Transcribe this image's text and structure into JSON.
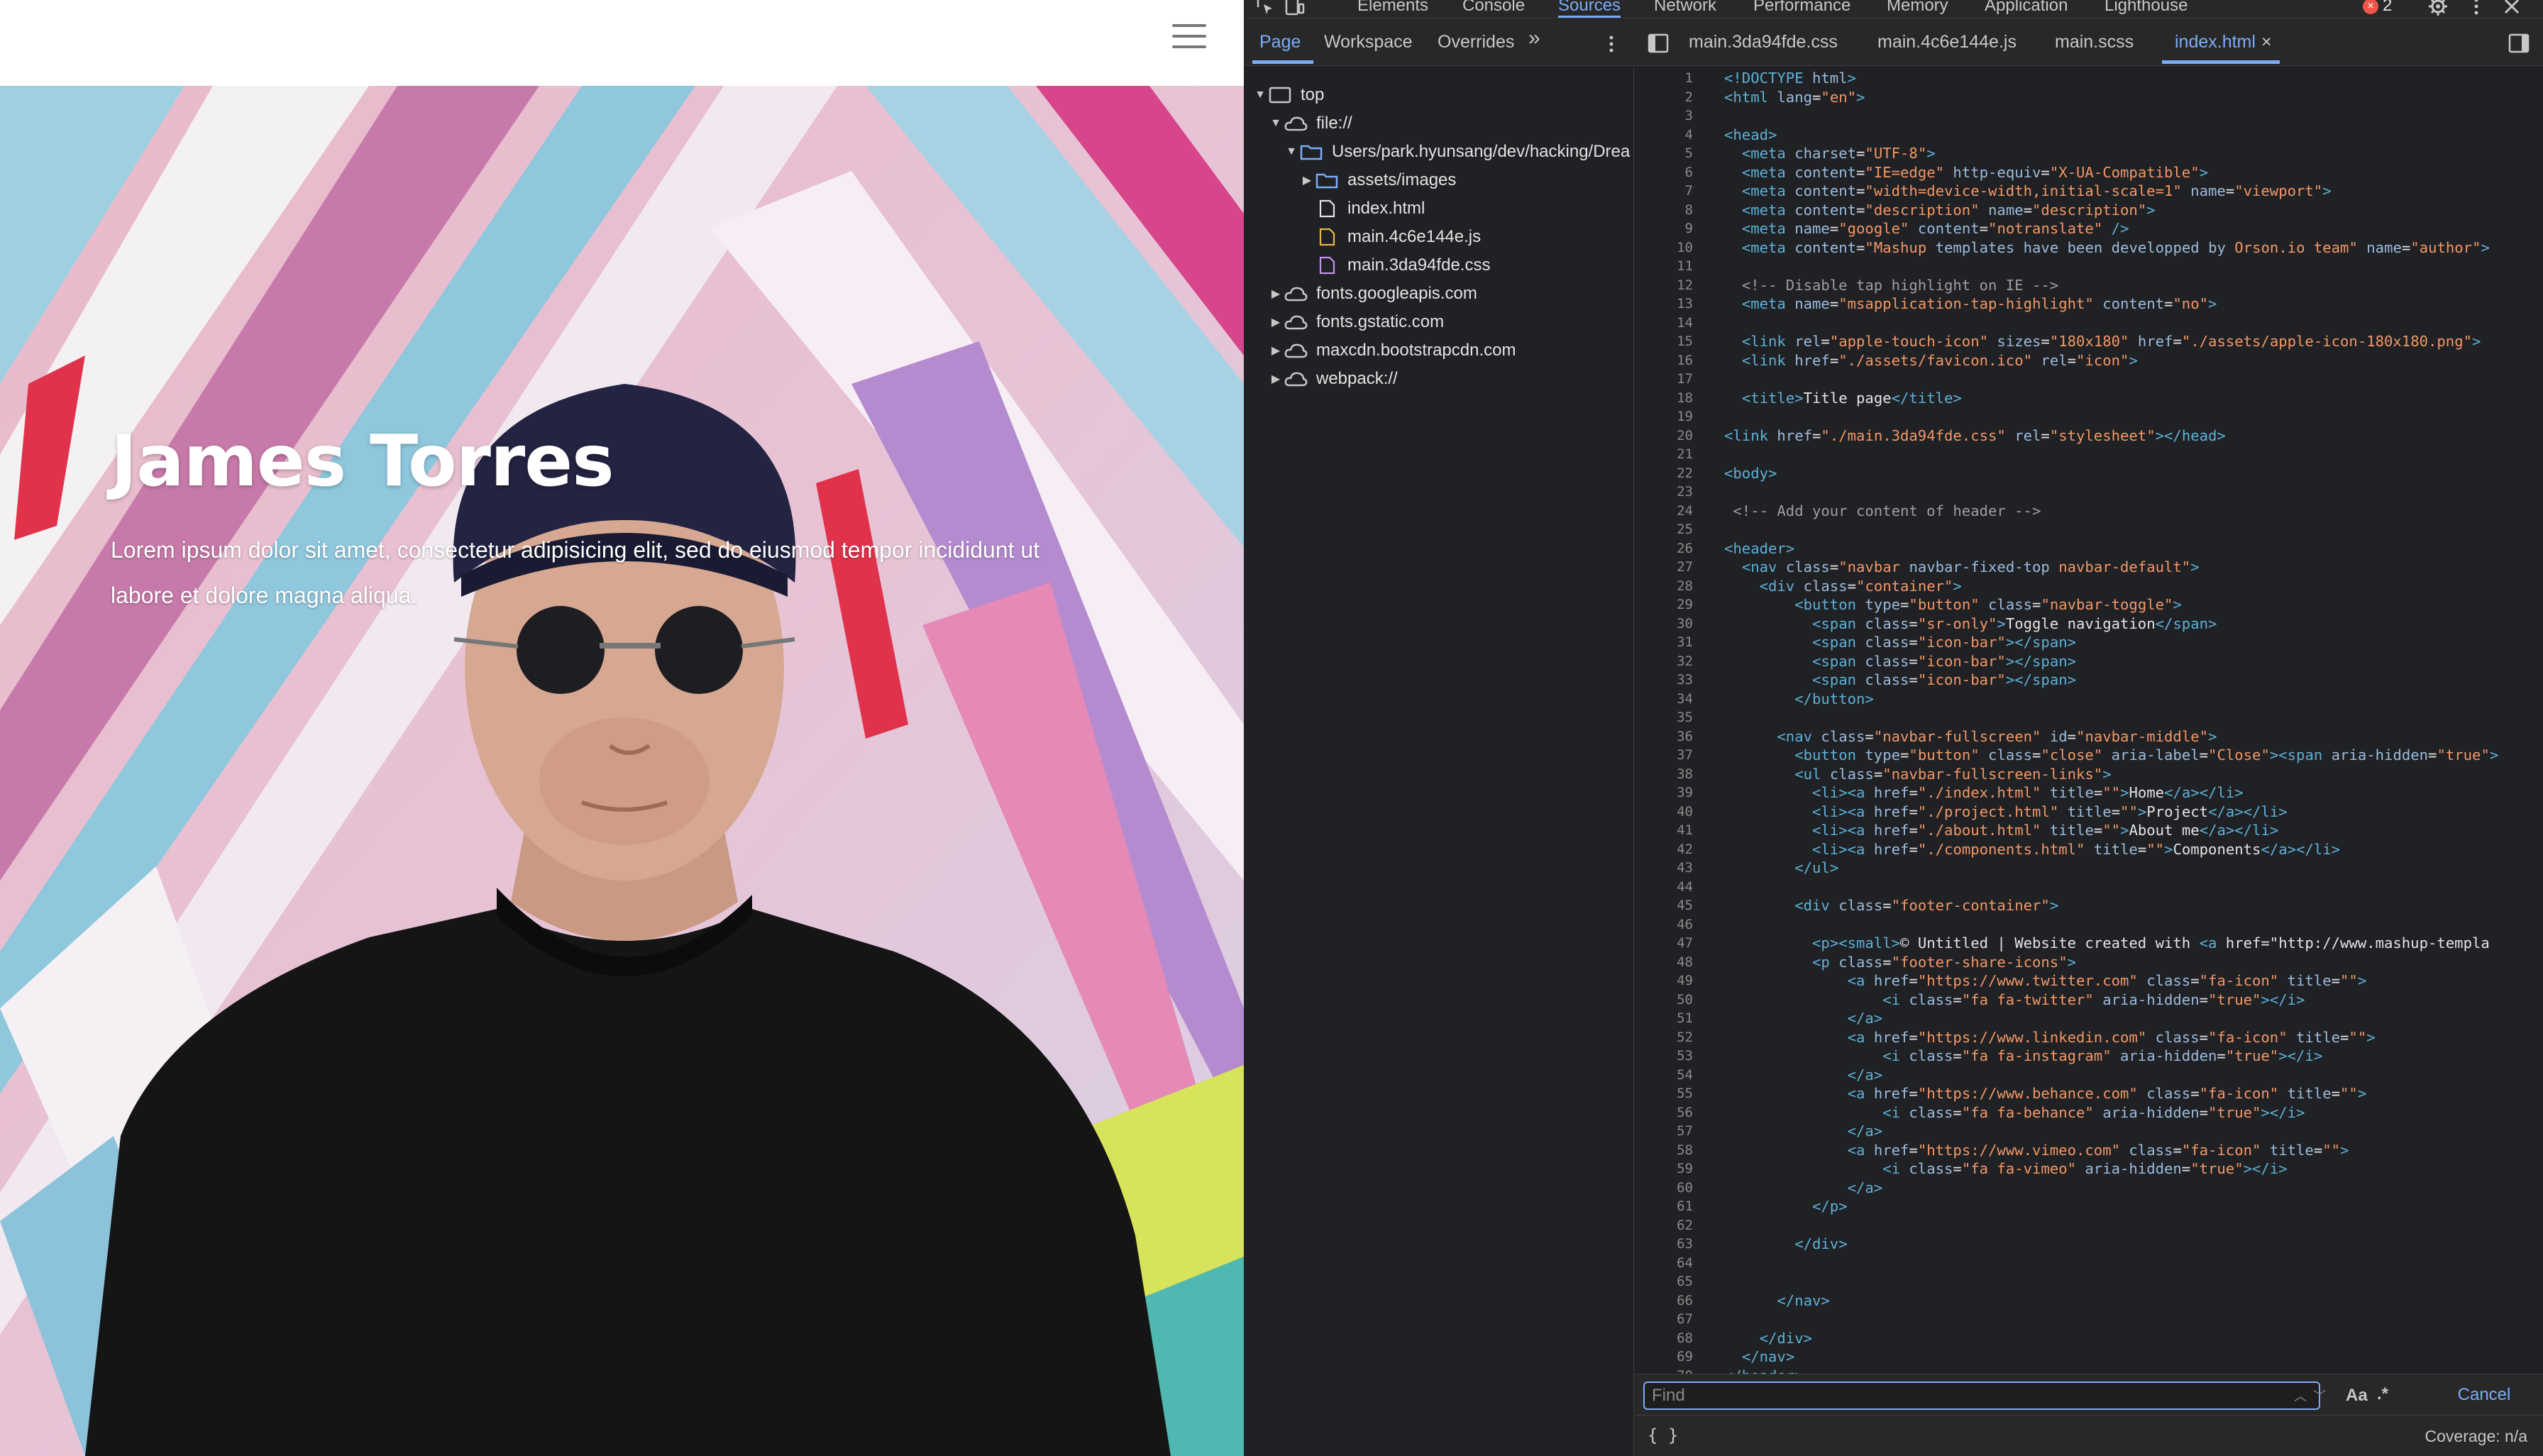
{
  "site": {
    "hero_title": "James Torres",
    "hero_text": "Lorem ipsum dolor sit amet, consectetur adipisicing elit, sed do eiusmod tempor incididunt ut labore et dolore magna aliqua."
  },
  "devtools": {
    "tabs": [
      "Elements",
      "Console",
      "Sources",
      "Network",
      "Performance",
      "Memory",
      "Application",
      "Lighthouse"
    ],
    "active_tab": "Sources",
    "error_count": "2",
    "sub_tabs": [
      "Page",
      "Workspace",
      "Overrides"
    ],
    "more_tabs": "»",
    "file_tabs": [
      "main.3da94fde.css",
      "main.4c6e144e.js",
      "main.scss",
      "index.html"
    ],
    "close_glyph": "×",
    "tree": {
      "top": "top",
      "file": "file://",
      "folder": "Users/park.hyunsang/dev/hacking/Drea",
      "assets": "assets/images",
      "index": "index.html",
      "js": "main.4c6e144e.js",
      "css": "main.3da94fde.css",
      "googleapis": "fonts.googleapis.com",
      "gstatic": "fonts.gstatic.com",
      "bootstrap": "maxcdn.bootstrapcdn.com",
      "webpack": "webpack://"
    },
    "find_placeholder": "Find",
    "find_case": "Aa",
    "find_regex": ".*",
    "cancel": "Cancel",
    "pretty_print": "{ }",
    "coverage": "Coverage: n/a",
    "code_lines": [
      "<!DOCTYPE html>",
      "<html lang=\"en\">",
      "",
      "<head>",
      "  <meta charset=\"UTF-8\">",
      "  <meta content=\"IE=edge\" http-equiv=\"X-UA-Compatible\">",
      "  <meta content=\"width=device-width,initial-scale=1\" name=\"viewport\">",
      "  <meta content=\"description\" name=\"description\">",
      "  <meta name=\"google\" content=\"notranslate\" />",
      "  <meta content=\"Mashup templates have been developped by Orson.io team\" name=\"author\">",
      "",
      "  <!-- Disable tap highlight on IE -->",
      "  <meta name=\"msapplication-tap-highlight\" content=\"no\">",
      "",
      "  <link rel=\"apple-touch-icon\" sizes=\"180x180\" href=\"./assets/apple-icon-180x180.png\">",
      "  <link href=\"./assets/favicon.ico\" rel=\"icon\">",
      "",
      "  <title>Title page</title>",
      "",
      "<link href=\"./main.3da94fde.css\" rel=\"stylesheet\"></head>",
      "",
      "<body>",
      "",
      " <!-- Add your content of header -->",
      "",
      "<header>",
      "  <nav class=\"navbar navbar-fixed-top navbar-default\">",
      "    <div class=\"container\">",
      "        <button type=\"button\" class=\"navbar-toggle\">",
      "          <span class=\"sr-only\">Toggle navigation</span>",
      "          <span class=\"icon-bar\"></span>",
      "          <span class=\"icon-bar\"></span>",
      "          <span class=\"icon-bar\"></span>",
      "        </button>",
      "",
      "      <nav class=\"navbar-fullscreen\" id=\"navbar-middle\">",
      "        <button type=\"button\" class=\"close\" aria-label=\"Close\"><span aria-hidden=\"true\">",
      "        <ul class=\"navbar-fullscreen-links\">",
      "          <li><a href=\"./index.html\" title=\"\">Home</a></li>",
      "          <li><a href=\"./project.html\" title=\"\">Project</a></li>",
      "          <li><a href=\"./about.html\" title=\"\">About me</a></li>",
      "          <li><a href=\"./components.html\" title=\"\">Components</a></li>",
      "        </ul>",
      "",
      "        <div class=\"footer-container\">",
      "",
      "          <p><small>© Untitled | Website created with <a href=\"http://www.mashup-templa",
      "          <p class=\"footer-share-icons\">",
      "              <a href=\"https://www.twitter.com\" class=\"fa-icon\" title=\"\">",
      "                  <i class=\"fa fa-twitter\" aria-hidden=\"true\"></i>",
      "              </a>",
      "              <a href=\"https://www.linkedin.com\" class=\"fa-icon\" title=\"\">",
      "                  <i class=\"fa fa-instagram\" aria-hidden=\"true\"></i>",
      "              </a>",
      "              <a href=\"https://www.behance.com\" class=\"fa-icon\" title=\"\">",
      "                  <i class=\"fa fa-behance\" aria-hidden=\"true\"></i>",
      "              </a>",
      "              <a href=\"https://www.vimeo.com\" class=\"fa-icon\" title=\"\">",
      "                  <i class=\"fa fa-vimeo\" aria-hidden=\"true\"></i>",
      "              </a>",
      "          </p>",
      "",
      "        </div>",
      "",
      "",
      "      </nav>",
      "",
      "    </div>",
      "  </nav>",
      "</header>"
    ]
  },
  "colors": {
    "accent": "#7cacf8",
    "tag": "#5db0d7",
    "attr": "#9bbbdc",
    "value": "#f29766",
    "comment": "#9e9e9e",
    "error": "#f2564a"
  }
}
